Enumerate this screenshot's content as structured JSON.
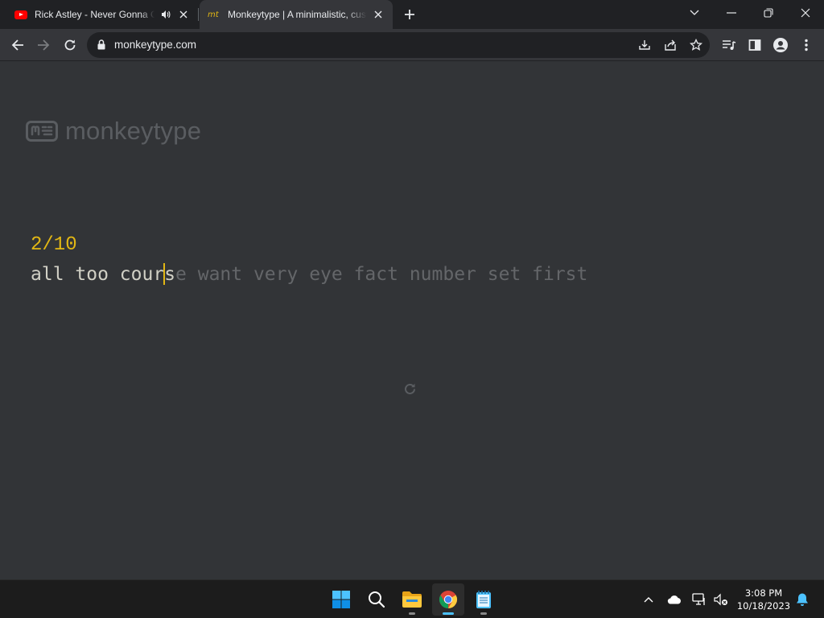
{
  "browser": {
    "tabs": [
      {
        "title": "Rick Astley - Never Gonna Give You Up",
        "favicon": "youtube-icon",
        "audio": "speaker-icon"
      },
      {
        "title": "Monkeytype | A minimalistic, customizable typing test",
        "favicon_text": "mt"
      }
    ],
    "address": "monkeytype.com"
  },
  "page": {
    "logo_text": "monkeytype",
    "progress": "2/10",
    "typed_text": "all too cour",
    "current_letter": "s",
    "untyped_text": "e want very eye fact number set first"
  },
  "taskbar": {
    "time": "3:08 PM",
    "date": "10/18/2023"
  },
  "colors": {
    "background": "#323437",
    "accent": "#e2b714",
    "typed": "#d1d0c5",
    "untyped": "#646669"
  }
}
